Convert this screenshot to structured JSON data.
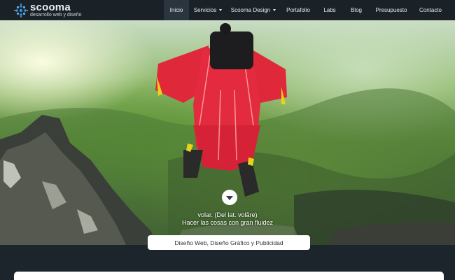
{
  "brand": {
    "name": "scooma",
    "tagline": "desarrollo web y diseño",
    "icon": "flower-dots-logo"
  },
  "nav": {
    "items": [
      {
        "label": "Inicio",
        "active": true,
        "dropdown": false
      },
      {
        "label": "Servicios",
        "active": false,
        "dropdown": true
      },
      {
        "label": "Scooma Design",
        "active": false,
        "dropdown": true
      },
      {
        "label": "Portafolio",
        "active": false,
        "dropdown": false
      },
      {
        "label": "Labs",
        "active": false,
        "dropdown": false
      },
      {
        "label": "Blog",
        "active": false,
        "dropdown": false
      },
      {
        "label": "Presupuesto",
        "active": false,
        "dropdown": false
      },
      {
        "label": "Contacto",
        "active": false,
        "dropdown": false
      }
    ]
  },
  "hero": {
    "image": "wingsuit-flyer-over-green-mountains",
    "scroll_icon": "chevron-down-icon",
    "quote_line1": "volar. (Del lat. volāre)",
    "quote_line2": "Hacer las cosas con gran fluidez"
  },
  "tagline_pill": "Diseño Web, Diseño Gráfico y Publicidad",
  "colors": {
    "navbar": "#1a2228",
    "nav_active": "#2a353e",
    "page_bg": "#1c252c",
    "logo_blue": "#3a8fd6",
    "suit_red": "#e0283b"
  }
}
